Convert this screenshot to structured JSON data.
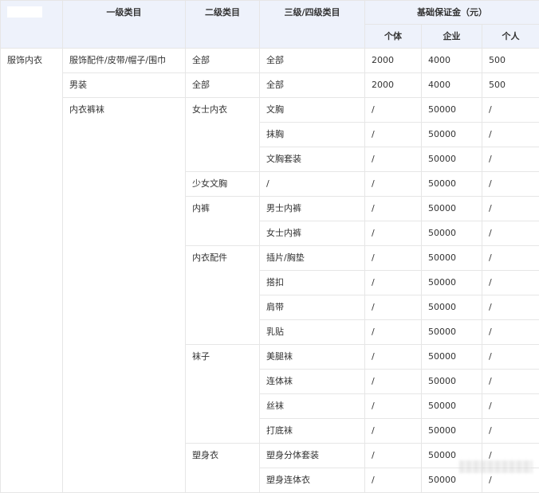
{
  "header": {
    "corner": "",
    "level1": "一级类目",
    "level2": "二级类目",
    "level34": "三级/四级类目",
    "deposit": "基础保证金（元）",
    "individual": "个体",
    "enterprise": "企业",
    "personal": "个人"
  },
  "group": {
    "name": "服饰内衣"
  },
  "sections": [
    {
      "level1": "服饰配件/皮带/帽子/围巾",
      "subs": [
        {
          "level2": "全部",
          "rows": [
            {
              "level34": "全部",
              "individual": "2000",
              "enterprise": "4000",
              "personal": "500"
            }
          ]
        }
      ]
    },
    {
      "level1": "男装",
      "subs": [
        {
          "level2": "全部",
          "rows": [
            {
              "level34": "全部",
              "individual": "2000",
              "enterprise": "4000",
              "personal": "500"
            }
          ]
        }
      ]
    },
    {
      "level1": "内衣裤袜",
      "subs": [
        {
          "level2": "女士内衣",
          "rows": [
            {
              "level34": "文胸",
              "individual": "/",
              "enterprise": "50000",
              "personal": "/"
            },
            {
              "level34": "抹胸",
              "individual": "/",
              "enterprise": "50000",
              "personal": "/"
            },
            {
              "level34": "文胸套装",
              "individual": "/",
              "enterprise": "50000",
              "personal": "/"
            }
          ]
        },
        {
          "level2": "少女文胸",
          "rows": [
            {
              "level34": "/",
              "individual": "/",
              "enterprise": "50000",
              "personal": "/"
            }
          ]
        },
        {
          "level2": "内裤",
          "rows": [
            {
              "level34": "男士内裤",
              "individual": "/",
              "enterprise": "50000",
              "personal": "/"
            },
            {
              "level34": "女士内裤",
              "individual": "/",
              "enterprise": "50000",
              "personal": "/"
            }
          ]
        },
        {
          "level2": "内衣配件",
          "rows": [
            {
              "level34": "插片/胸垫",
              "individual": "/",
              "enterprise": "50000",
              "personal": "/"
            },
            {
              "level34": "搭扣",
              "individual": "/",
              "enterprise": "50000",
              "personal": "/"
            },
            {
              "level34": "肩带",
              "individual": "/",
              "enterprise": "50000",
              "personal": "/"
            },
            {
              "level34": "乳贴",
              "individual": "/",
              "enterprise": "50000",
              "personal": "/"
            }
          ]
        },
        {
          "level2": "袜子",
          "rows": [
            {
              "level34": "美腿袜",
              "individual": "/",
              "enterprise": "50000",
              "personal": "/"
            },
            {
              "level34": "连体袜",
              "individual": "/",
              "enterprise": "50000",
              "personal": "/"
            },
            {
              "level34": "丝袜",
              "individual": "/",
              "enterprise": "50000",
              "personal": "/"
            },
            {
              "level34": "打底袜",
              "individual": "/",
              "enterprise": "50000",
              "personal": "/"
            }
          ]
        },
        {
          "level2": "塑身衣",
          "rows": [
            {
              "level34": "塑身分体套装",
              "individual": "/",
              "enterprise": "50000",
              "personal": "/"
            },
            {
              "level34": "塑身连体衣",
              "individual": "/",
              "enterprise": "50000",
              "personal": "/"
            }
          ]
        }
      ]
    }
  ]
}
